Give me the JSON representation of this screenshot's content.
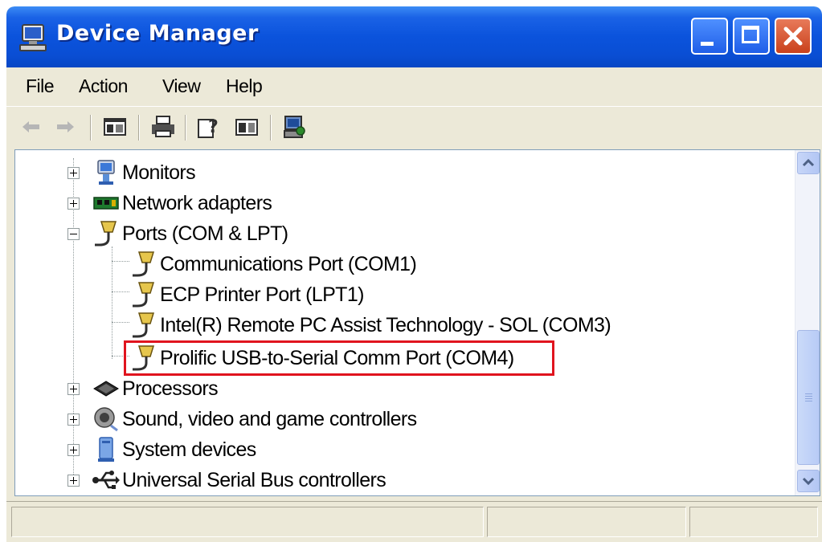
{
  "window": {
    "title": "Device Manager",
    "title_icon": "computer-icon",
    "controls": [
      "minimize-icon",
      "maximize-icon",
      "close-icon"
    ]
  },
  "menu": {
    "file": "File",
    "action": "Action",
    "view": "View",
    "help": "Help"
  },
  "toolbar": {
    "icons": [
      "back-arrow-icon",
      "forward-arrow-icon",
      "show-hide-console-tree-icon",
      "print-icon",
      "help-icon",
      "properties-icon",
      "scan-hardware-icon"
    ]
  },
  "tree": {
    "items": [
      {
        "label": "Monitors",
        "icon": "monitor-icon",
        "expanded": false
      },
      {
        "label": "Network adapters",
        "icon": "network-card-icon",
        "expanded": false
      },
      {
        "label": "Ports (COM & LPT)",
        "icon": "port-connector-icon",
        "expanded": true
      },
      {
        "label": "Communications Port (COM1)",
        "icon": "port-connector-icon",
        "child": true
      },
      {
        "label": "ECP Printer Port (LPT1)",
        "icon": "port-connector-icon",
        "child": true
      },
      {
        "label": "Intel(R) Remote PC Assist Technology - SOL (COM3)",
        "icon": "port-connector-icon",
        "child": true
      },
      {
        "label": "Prolific USB-to-Serial Comm Port (COM4)",
        "icon": "port-connector-icon",
        "child": true,
        "highlighted": true
      },
      {
        "label": "Processors",
        "icon": "processor-icon",
        "expanded": false
      },
      {
        "label": "Sound, video and game controllers",
        "icon": "speaker-icon",
        "expanded": false
      },
      {
        "label": "System devices",
        "icon": "system-computer-icon",
        "expanded": false
      },
      {
        "label": "Universal Serial Bus controllers",
        "icon": "usb-icon",
        "expanded": false
      }
    ]
  },
  "colors": {
    "titlebar": "#0b53dc",
    "highlight_border": "#e0141e",
    "window_bg": "#ece9d8"
  }
}
